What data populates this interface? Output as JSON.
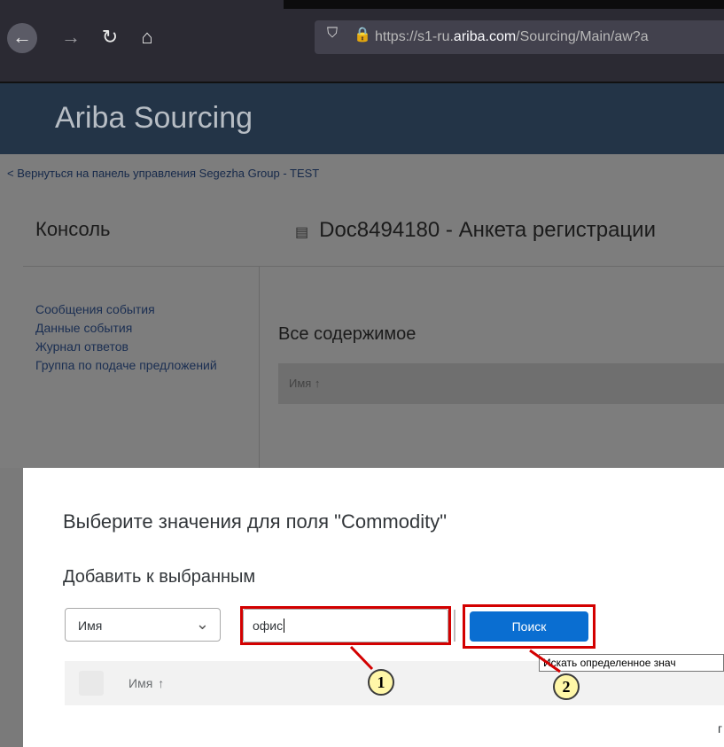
{
  "browser": {
    "url_prefix": "https://s1-ru.",
    "url_domain": "ariba.com",
    "url_suffix": "/Sourcing/Main/aw?a"
  },
  "app": {
    "title": "Ariba Sourcing"
  },
  "page": {
    "back_link": "< Вернуться на панель управления Segezha Group - TEST",
    "console_title": "Консоль",
    "doc_title": "Doc8494180 - Анкета регистрации",
    "sidebar": {
      "items": [
        {
          "label": "Сообщения события"
        },
        {
          "label": "Данные события"
        },
        {
          "label": "Журнал ответов"
        },
        {
          "label": "Группа по подаче предложений"
        }
      ]
    },
    "all_content_title": "Все содержимое",
    "column_header": "Имя ↑"
  },
  "dialog": {
    "title": "Выберите значения для поля \"Commodity\"",
    "subtitle": "Добавить к выбранным",
    "field_select_value": "Имя",
    "search_input_value": "офис",
    "search_button": "Поиск",
    "tooltip": "Искать определенное знач",
    "table_header": "Имя",
    "sort_arrow": "↑",
    "pager_text": "г"
  },
  "callouts": [
    "1",
    "2"
  ],
  "colors": {
    "header_bg": "#233447",
    "button_blue": "#0a6ed1",
    "highlight_red": "#d30000",
    "callout_yellow": "#fff7a8"
  }
}
